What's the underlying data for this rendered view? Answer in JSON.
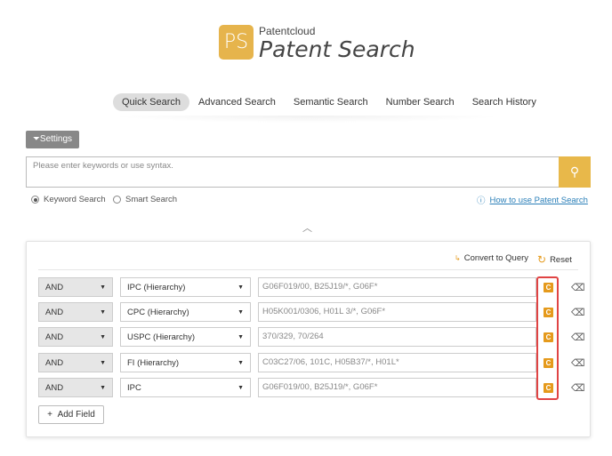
{
  "brand": {
    "logo_text": "PS",
    "small": "Patentcloud",
    "title": "Patent Search"
  },
  "tabs": [
    {
      "label": "Quick Search",
      "active": true
    },
    {
      "label": "Advanced Search"
    },
    {
      "label": "Semantic Search"
    },
    {
      "label": "Number Search"
    },
    {
      "label": "Search History"
    }
  ],
  "settings_label": "Settings",
  "search": {
    "placeholder": "Please enter keywords or use syntax.",
    "button_icon": "search-icon"
  },
  "modes": [
    {
      "label": "Keyword Search",
      "checked": true
    },
    {
      "label": "Smart Search",
      "checked": false
    }
  ],
  "help_link": "How to use Patent Search",
  "toolbar": {
    "convert": "Convert to Query",
    "reset": "Reset"
  },
  "rows": [
    {
      "op": "AND",
      "field": "IPC (Hierarchy)",
      "placeholder": "G06F019/00, B25J19/*, G06F*"
    },
    {
      "op": "AND",
      "field": "CPC (Hierarchy)",
      "placeholder": "H05K001/0306, H01L 3/*, G06F*"
    },
    {
      "op": "AND",
      "field": "USPC (Hierarchy)",
      "placeholder": "370/329, 70/264"
    },
    {
      "op": "AND",
      "field": "FI (Hierarchy)",
      "placeholder": "C03C27/06, 101C, H05B37/*, H01L*"
    },
    {
      "op": "AND",
      "field": "IPC",
      "placeholder": "G06F019/00, B25J19/*, G06F*"
    }
  ],
  "row_icon_letter": "C",
  "add_field": "Add Field",
  "colors": {
    "accent": "#e8b84a",
    "highlight": "#e04444",
    "code_icon": "#e59a1c"
  }
}
